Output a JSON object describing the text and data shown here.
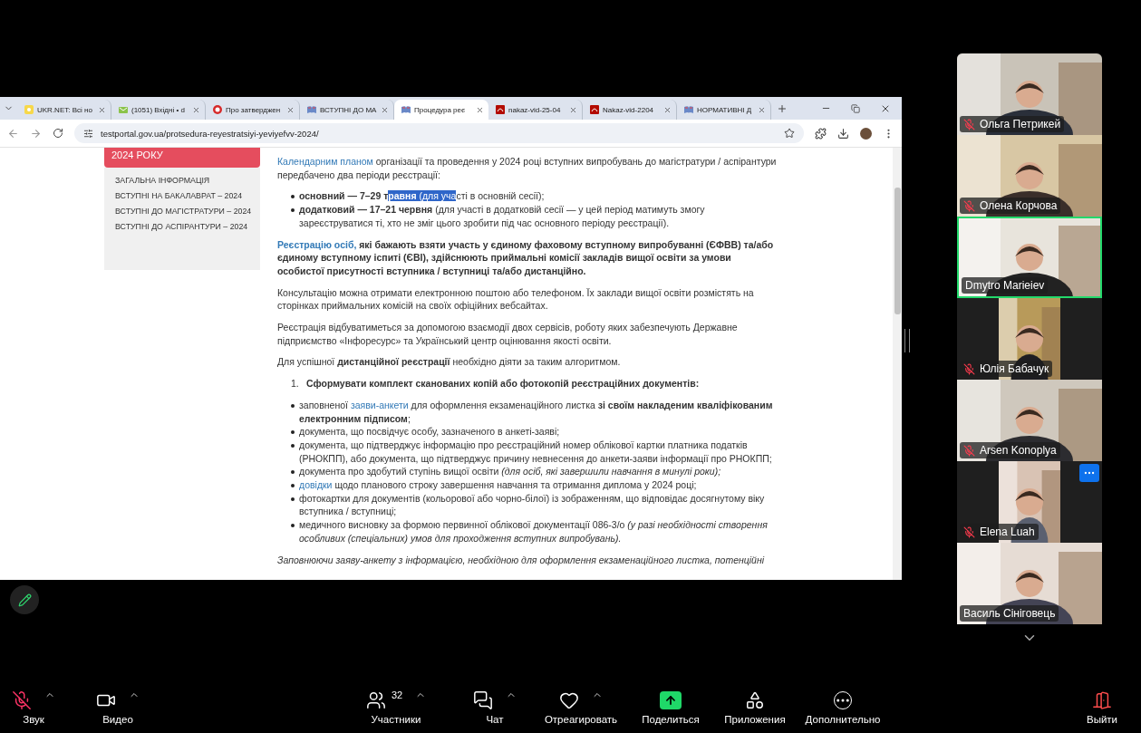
{
  "browser": {
    "tabs": [
      {
        "title": "UKR.NET: Всі но",
        "kind": "ukrnet",
        "selected": false
      },
      {
        "title": "(1051) Вхідні • d",
        "kind": "mail",
        "selected": false
      },
      {
        "title": "Про затверджен",
        "kind": "stop",
        "selected": false
      },
      {
        "title": "ВСТУПНІ ДО МА",
        "kind": "book",
        "selected": false
      },
      {
        "title": "Процедура реє",
        "kind": "book",
        "selected": true
      },
      {
        "title": "nakaz-vid-25-04",
        "kind": "pdf",
        "selected": false
      },
      {
        "title": "Nakaz-vid-2204",
        "kind": "pdf",
        "selected": false
      },
      {
        "title": "НОРМАТИВНІ Д",
        "kind": "book",
        "selected": false
      }
    ],
    "url": "testportal.gov.ua/protsedura-reyestratsiyi-yeviyefvv-2024/"
  },
  "sidebar": {
    "heading": "2024 РОКУ",
    "items": [
      "ЗАГАЛЬНА ІНФОРМАЦІЯ",
      "ВСТУПНІ НА БАКАЛАВРАТ – 2024",
      "ВСТУПНІ ДО МАГІСТРАТУРИ – 2024",
      "ВСТУПНІ ДО АСПІРАНТУРИ – 2024"
    ]
  },
  "content": [
    {
      "kind": "para",
      "parts": [
        {
          "kind": "link",
          "text": "Календарним планом"
        },
        {
          "kind": "text",
          "text": " організації та проведення у 2024 році вступних випробувань до магістратури / аспірантури передбачено два періоди реєстрації:"
        }
      ]
    },
    {
      "kind": "bullets",
      "items": [
        {
          "parts": [
            {
              "kind": "text",
              "text": "**основний — 7–29 т**"
            },
            {
              "kind": "highlight",
              "text": "**равня** (для уча"
            },
            {
              "kind": "text",
              "text": "сті в основній сесії);"
            }
          ]
        },
        {
          "parts": [
            {
              "kind": "text",
              "text": "**додатковий — 17–21 червня** (для участі в додатковій сесії — у цей період матимуть змогу зареєструватися ті, хто не зміг цього зробити під час основного періоду реєстрації)."
            }
          ]
        }
      ]
    },
    {
      "kind": "para",
      "parts": [
        {
          "kind": "link",
          "text": "**Реєстрацію осіб,**"
        },
        {
          "kind": "text",
          "text": " **які бажають взяти участь у єдиному фаховому вступному випробуванні (ЄФВВ) та/або єдиному вступному іспиті (ЄВІ),  здійснюють приймальні комісії закладів вищої освіти за умови особистої присутності вступника / вступниці та/або дистанційно.**"
        }
      ]
    },
    {
      "kind": "para",
      "parts": [
        {
          "kind": "text",
          "text": "Консультацію можна отримати електронною поштою або телефоном. Їх заклади вищої освіти розмістять на сторінках приймальних комісій на своїх офіційних вебсайтах."
        }
      ]
    },
    {
      "kind": "para",
      "parts": [
        {
          "kind": "text",
          "text": "Реєстрація відбуватиметься за допомогою взаємодії двох сервісів, роботу яких забезпечують Державне підприємство «Інфоресурс» та Український центр оцінювання якості освіти."
        }
      ]
    },
    {
      "kind": "para",
      "parts": [
        {
          "kind": "text",
          "text": "Для успішної **дистанційної реєстрації** необхідно діяти за таким алгоритмом."
        }
      ]
    },
    {
      "kind": "numbered",
      "number": "1.",
      "parts": [
        {
          "kind": "text",
          "text": "**Сформувати комплект сканованих копій або фотокопій реєстраційних документів:**"
        }
      ]
    },
    {
      "kind": "bullets",
      "items": [
        {
          "parts": [
            {
              "kind": "text",
              "text": "заповненої "
            },
            {
              "kind": "link",
              "text": "заяви-анкети"
            },
            {
              "kind": "text",
              "text": " для оформлення екзаменаційного листка **зі своїм накладеним кваліфікованим електронним підписом**;"
            }
          ]
        },
        {
          "parts": [
            {
              "kind": "text",
              "text": "документа, що посвідчує особу, зазначеного в анкеті-заяві;"
            }
          ]
        },
        {
          "parts": [
            {
              "kind": "text",
              "text": "документа, що підтверджує інформацію про  реєстраційний номер облікової картки платника податків (РНОКПП), або документа, що підтверджує причину невнесення до анкети-заяви інформації про РНОКПП;"
            }
          ]
        },
        {
          "parts": [
            {
              "kind": "text",
              "text": "документа про здобутий ступінь вищої освіти *(для осіб, які завершили навчання в минулі роки);*"
            }
          ]
        },
        {
          "parts": [
            {
              "kind": "link",
              "text": "довідки"
            },
            {
              "kind": "text",
              "text": " щодо планового строку завершення навчання та отримання диплома у 2024 році;"
            }
          ]
        },
        {
          "parts": [
            {
              "kind": "text",
              "text": "фотокартки для документів (кольорової або чорно-білої) із зображенням, що відповідає досягнутому віку вступника / вступниці;"
            }
          ]
        },
        {
          "parts": [
            {
              "kind": "text",
              "text": "медичного висновку за формою первинної облікової документації 086-3/о *(у разі необхідності створення особливих (спеціальних) умов для проходження вступних випробувань).*"
            }
          ]
        }
      ]
    },
    {
      "kind": "note",
      "parts": [
        {
          "kind": "text",
          "text": "Заповнюючи заяву-анкету з інформацією, необхідною для оформлення екзаменаційного листка, потенційні"
        }
      ]
    }
  ],
  "participants": [
    {
      "name": "Ольга Петрикей",
      "muted": true,
      "active": false,
      "kind": "full",
      "menu": false
    },
    {
      "name": "Олена Корчова",
      "muted": true,
      "active": false,
      "kind": "full",
      "menu": false
    },
    {
      "name": "Dmytro Marieiev",
      "muted": false,
      "active": true,
      "kind": "full",
      "menu": false
    },
    {
      "name": "Юлія Бабачук",
      "muted": true,
      "active": false,
      "kind": "narrow",
      "menu": false
    },
    {
      "name": "Arsen Konoplya",
      "muted": true,
      "active": false,
      "kind": "full",
      "menu": false
    },
    {
      "name": "Elena Luah",
      "muted": true,
      "active": false,
      "kind": "narrow",
      "menu": true
    },
    {
      "name": "Василь Сініговець",
      "muted": false,
      "active": false,
      "kind": "full",
      "menu": false
    }
  ],
  "toolbar": [
    {
      "kind": "mic",
      "label": "Звук",
      "muted": true,
      "caret": true
    },
    {
      "kind": "video",
      "label": "Видео",
      "caret": true
    },
    {
      "kind": "users",
      "label": "Участники",
      "count": "32",
      "caret": true
    },
    {
      "kind": "chat",
      "label": "Чат",
      "caret": true
    },
    {
      "kind": "heart",
      "label": "Отреагировать",
      "caret": true
    },
    {
      "kind": "share",
      "label": "Поделиться",
      "caret": false
    },
    {
      "kind": "apps",
      "label": "Приложения",
      "caret": false
    },
    {
      "kind": "more",
      "label": "Дополнительно",
      "caret": false
    },
    {
      "kind": "leave",
      "label": "Выйти",
      "caret": false
    }
  ]
}
